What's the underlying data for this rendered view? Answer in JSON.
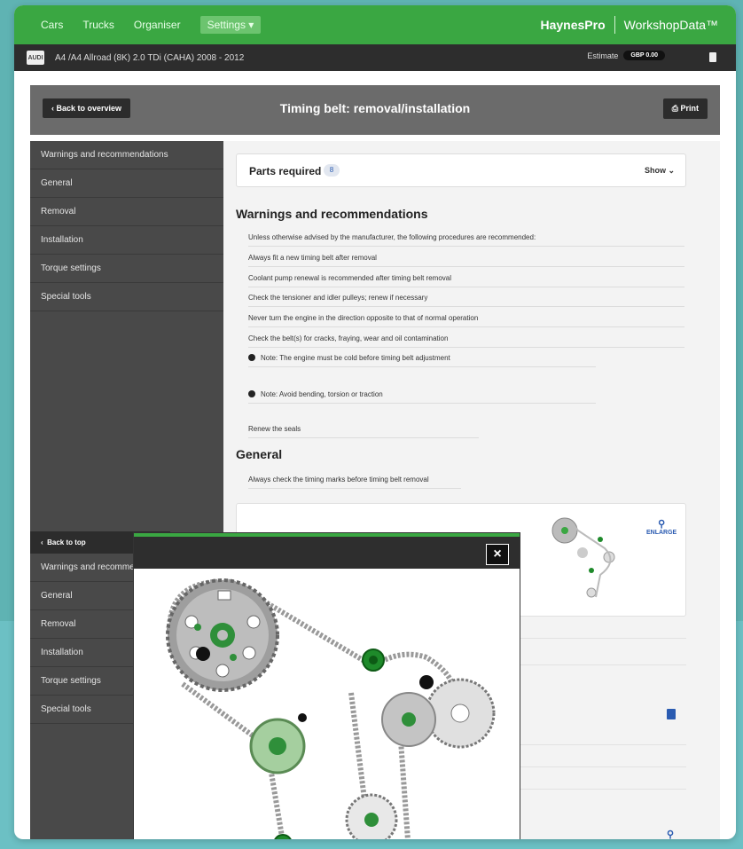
{
  "topbar": {
    "nav": [
      "Cars",
      "Trucks",
      "Organiser"
    ],
    "settings_label": "Settings",
    "brand_haynes": "HaynesPro",
    "brand_workshop": "WorkshopData™"
  },
  "vehicle": {
    "logo_text": "AUDI",
    "name": "A4 /A4 Allroad (8K) 2.0 TDi (CAHA) 2008 - 2012",
    "estimate_label": "Estimate",
    "estimate_value": "GBP 0.00"
  },
  "header": {
    "back_label": "Back to overview",
    "title": "Timing belt: removal/installation",
    "print_label": "Print"
  },
  "sidebar": {
    "items": [
      "Warnings and recommendations",
      "General",
      "Removal",
      "Installation",
      "Torque settings",
      "Special tools"
    ]
  },
  "parts": {
    "title": "Parts required",
    "count": "8",
    "show_label": "Show"
  },
  "warnings": {
    "title": "Warnings and recommendations",
    "lines": [
      "Unless otherwise advised by the manufacturer, the following procedures are recommended:",
      "Always fit a new timing belt after removal",
      "Coolant pump renewal is recommended after timing belt removal",
      "Check the tensioner and idler pulleys; renew if necessary",
      "Never turn the engine in the direction opposite to that of normal operation",
      "Check the belt(s) for cracks, fraying, wear and oil contamination"
    ],
    "note1": "Note: The engine must be cold before timing belt adjustment",
    "note2": "Note: Avoid bending, torsion or traction",
    "seals": "Renew the seals"
  },
  "general": {
    "title": "General",
    "line": "Always check the timing marks before timing belt removal"
  },
  "image_card": {
    "enlarge_label": "ENLARGE"
  },
  "sidebar2": {
    "back_label": "Back to top",
    "items": [
      "Warnings and recomme",
      "General",
      "Removal",
      "Installation",
      "Torque settings",
      "Special tools"
    ]
  },
  "modal": {
    "close_label": "×"
  },
  "colors": {
    "brand_green": "#3aa742",
    "dark_bar": "#2d2d2d",
    "sidebar": "#494949",
    "link_blue": "#2a5bb1"
  }
}
